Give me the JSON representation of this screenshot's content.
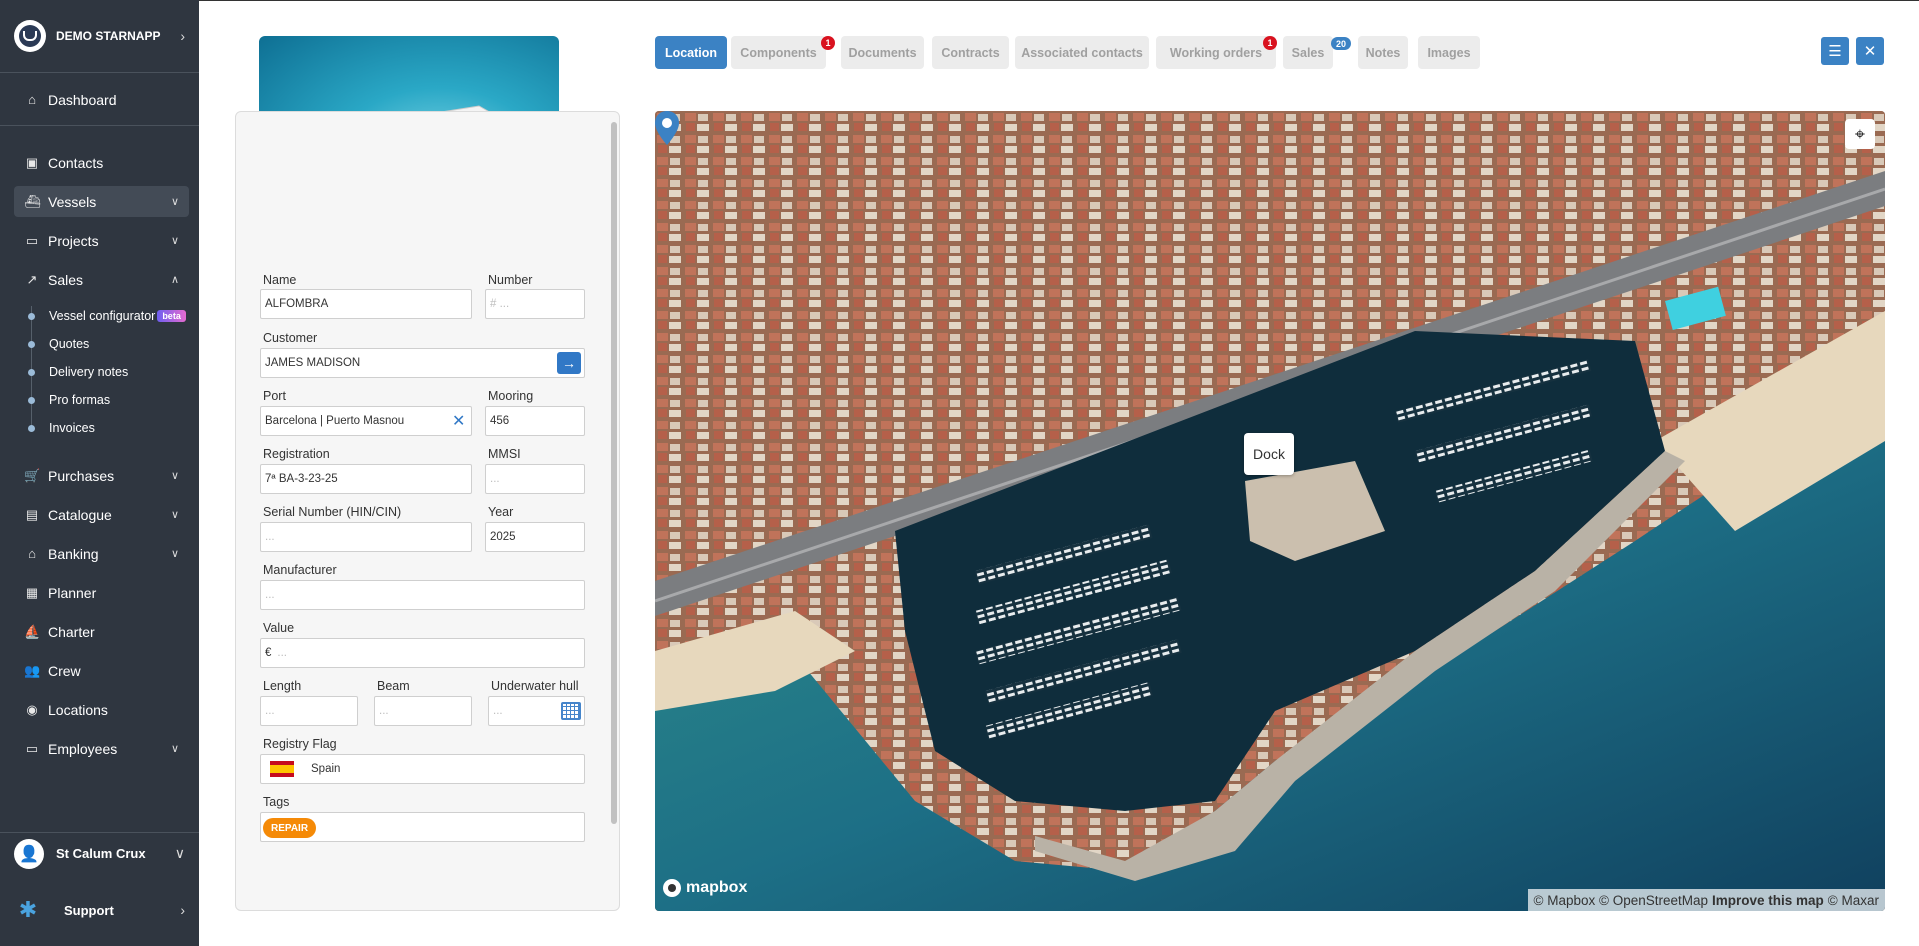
{
  "sidebar": {
    "company": "DEMO STARNAPP",
    "items": [
      {
        "label": "Dashboard",
        "icon": "home-icon"
      },
      {
        "label": "Contacts",
        "icon": "contacts-icon"
      },
      {
        "label": "Vessels",
        "icon": "ship-icon"
      },
      {
        "label": "Projects",
        "icon": "folder-icon"
      },
      {
        "label": "Sales",
        "icon": "chart-line-icon"
      },
      {
        "label": "Purchases",
        "icon": "cart-icon"
      },
      {
        "label": "Catalogue",
        "icon": "book-icon"
      },
      {
        "label": "Banking",
        "icon": "bank-icon"
      },
      {
        "label": "Planner",
        "icon": "calendar-icon"
      },
      {
        "label": "Charter",
        "icon": "sailboat-icon"
      },
      {
        "label": "Crew",
        "icon": "users-icon"
      },
      {
        "label": "Locations",
        "icon": "map-pin-icon"
      },
      {
        "label": "Employees",
        "icon": "id-card-icon"
      }
    ],
    "sales_sub": [
      "Vessel configurator",
      "Quotes",
      "Delivery notes",
      "Pro formas",
      "Invoices"
    ],
    "beta": "beta",
    "user": "St Calum Crux",
    "support": "Support"
  },
  "tabs": [
    {
      "label": "Location"
    },
    {
      "label": "Components",
      "badge": "1"
    },
    {
      "label": "Documents"
    },
    {
      "label": "Contracts"
    },
    {
      "label": "Associated contacts"
    },
    {
      "label": "Working orders",
      "badge": "1"
    },
    {
      "label": "Sales",
      "badge": "20"
    },
    {
      "label": "Notes"
    },
    {
      "label": "Images"
    }
  ],
  "form": {
    "name_label": "Name",
    "name_value": "ALFOMBRA",
    "number_label": "Number",
    "number_placeholder": "# ...",
    "customer_label": "Customer",
    "customer_value": "JAMES MADISON",
    "port_label": "Port",
    "port_value": "Barcelona | Puerto Masnou",
    "mooring_label": "Mooring",
    "mooring_value": "456",
    "registration_label": "Registration",
    "registration_value": "7ª BA-3-23-25",
    "mmsi_label": "MMSI",
    "mmsi_placeholder": "...",
    "serial_label": "Serial Number (HIN/CIN)",
    "serial_placeholder": "...",
    "year_label": "Year",
    "year_value": "2025",
    "manufacturer_label": "Manufacturer",
    "manufacturer_placeholder": "...",
    "value_label": "Value",
    "value_prefix": "€",
    "value_placeholder": "...",
    "length_label": "Length",
    "length_placeholder": "...",
    "beam_label": "Beam",
    "beam_placeholder": "...",
    "hull_label": "Underwater hull",
    "hull_placeholder": "...",
    "flag_label": "Registry Flag",
    "flag_value": "Spain",
    "tags_label": "Tags",
    "tag": "REPAIR"
  },
  "map": {
    "marker_label": "Dock",
    "logo": "mapbox",
    "attribution_1": "© Mapbox © OpenStreetMap",
    "attribution_link": "Improve this map",
    "attribution_2": "© Maxar"
  }
}
